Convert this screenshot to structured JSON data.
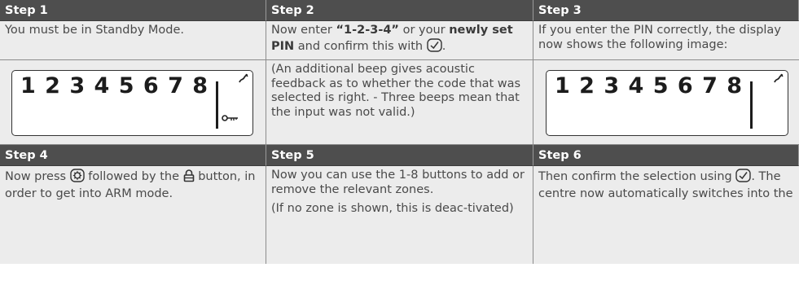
{
  "steps": [
    {
      "header": "Step  1",
      "text": "You must be in Standby Mode."
    },
    {
      "header": "Step  2",
      "text_a": "Now enter ",
      "text_b": "“1-2-3-4”",
      "text_c": " or your ",
      "text_d": "newly set PIN",
      "text_e": " and confirm this with ",
      "text_f": "."
    },
    {
      "header": "Step 3",
      "text": "If you enter the PIN correctly, the display now shows the following image:"
    },
    {
      "header": "Step  4",
      "text_a": "Now press ",
      "text_b": " followed by the ",
      "text_c": " button, in order to get into ARM mode."
    },
    {
      "header": "Step  5",
      "text": "Now you can use the 1-8 buttons to add or remove the relevant zones.",
      "text2": "(If no zone is shown, this is deac-tivated)"
    },
    {
      "header": "Step 6",
      "text_a": "Then confirm the selection using ",
      "text_b": ". The centre now automatically switches into the"
    }
  ],
  "step2_note": "(An additional beep gives acoustic feedback as to whether the code that was selected is right. - Three beeps mean that the input was not valid.)",
  "lcd": {
    "digits": "1 2 3 4 5 6 7 8"
  },
  "icons": [
    "confirm-check-icon",
    "settings-gear-icon",
    "padlock-icon",
    "key-icon",
    "antenna-signal-icon"
  ]
}
